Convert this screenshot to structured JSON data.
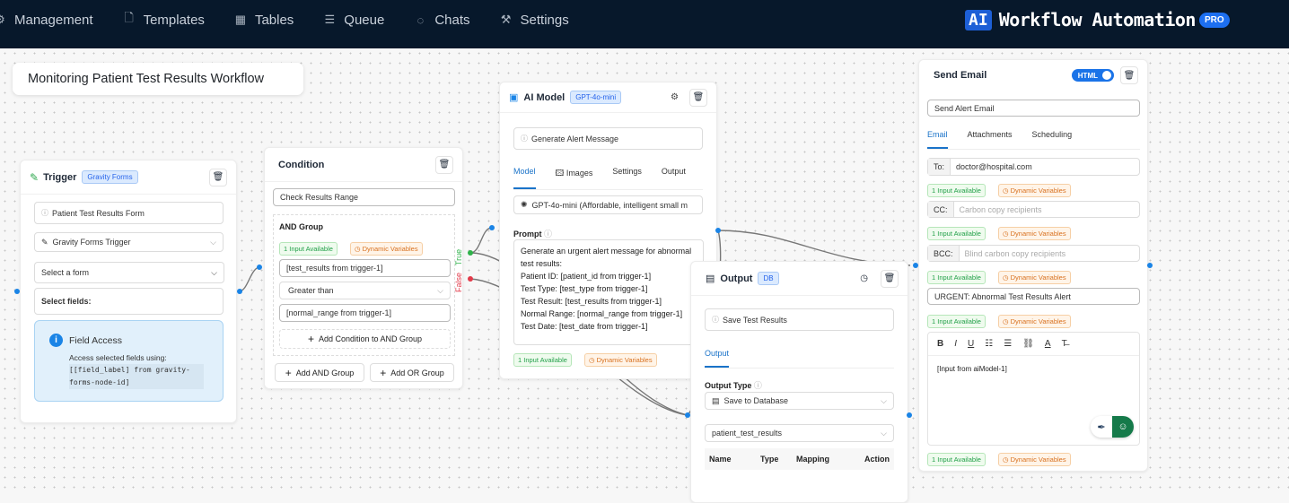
{
  "nav": {
    "items": [
      {
        "label": "Management",
        "icon": "gear-icon"
      },
      {
        "label": "Templates",
        "icon": "file-icon"
      },
      {
        "label": "Tables",
        "icon": "table-icon"
      },
      {
        "label": "Queue",
        "icon": "list-icon"
      },
      {
        "label": "Chats",
        "icon": "chat-icon"
      },
      {
        "label": "Settings",
        "icon": "wrench-icon"
      }
    ]
  },
  "brand": {
    "ai": "AI",
    "title": "Workflow Automation",
    "pro": "PRO"
  },
  "workflow_title": "Monitoring Patient Test Results Workflow",
  "trigger": {
    "title": "Trigger",
    "badge": "Gravity Forms",
    "name": "Patient Test Results Form",
    "type": "Gravity Forms Trigger",
    "form_select": "Select a form",
    "fields_label": "Select fields:",
    "info_title": "Field Access",
    "info_text": "Access selected fields using:",
    "info_code": "[[field_label] from gravity-forms-node-id]"
  },
  "condition": {
    "title": "Condition",
    "name": "Check Results Range",
    "group_label": "AND Group",
    "input_pill": "1 Input Available",
    "vars_pill": "Dynamic Variables",
    "left": "[test_results from trigger-1]",
    "operator": "Greater than",
    "right": "[normal_range from trigger-1]",
    "add_condition": "Add Condition to AND Group",
    "add_and": "Add AND Group",
    "add_or": "Add OR Group",
    "true_label": "True",
    "false_label": "False"
  },
  "ai_model": {
    "title": "AI Model",
    "badge": "GPT-4o-mini",
    "name": "Generate Alert Message",
    "tabs": [
      "Model",
      "Images",
      "Settings",
      "Output"
    ],
    "model": "GPT-4o-mini (Affordable, intelligent small m",
    "prompt_label": "Prompt",
    "prompt_lines": [
      "Generate an urgent alert message for abnormal",
      "test results:",
      "Patient ID: [patient_id from trigger-1]",
      "Test Type: [test_type from trigger-1]",
      "Test Result: [test_results from trigger-1]",
      "Normal Range: [normal_range from trigger-1]",
      "Test Date: [test_date from trigger-1]"
    ],
    "input_pill": "1 Input Available",
    "vars_pill": "Dynamic Variables"
  },
  "output": {
    "title": "Output",
    "badge": "DB",
    "name": "Save Test Results",
    "tab": "Output",
    "type_label": "Output Type",
    "type": "Save to Database",
    "table": "patient_test_results",
    "columns": [
      "Name",
      "Type",
      "Mapping",
      "Action"
    ]
  },
  "email": {
    "title": "Send Email",
    "toggle": "HTML",
    "name": "Send Alert Email",
    "tabs": [
      "Email",
      "Attachments",
      "Scheduling"
    ],
    "to_label": "To:",
    "to_value": "doctor@hospital.com",
    "cc_label": "CC:",
    "cc_placeholder": "Carbon copy recipients",
    "bcc_label": "BCC:",
    "bcc_placeholder": "Blind carbon copy recipients",
    "subject": "URGENT: Abnormal Test Results Alert",
    "body": "[Input from aiModel-1]",
    "input_pill": "1 Input Available",
    "vars_pill": "Dynamic Variables"
  }
}
